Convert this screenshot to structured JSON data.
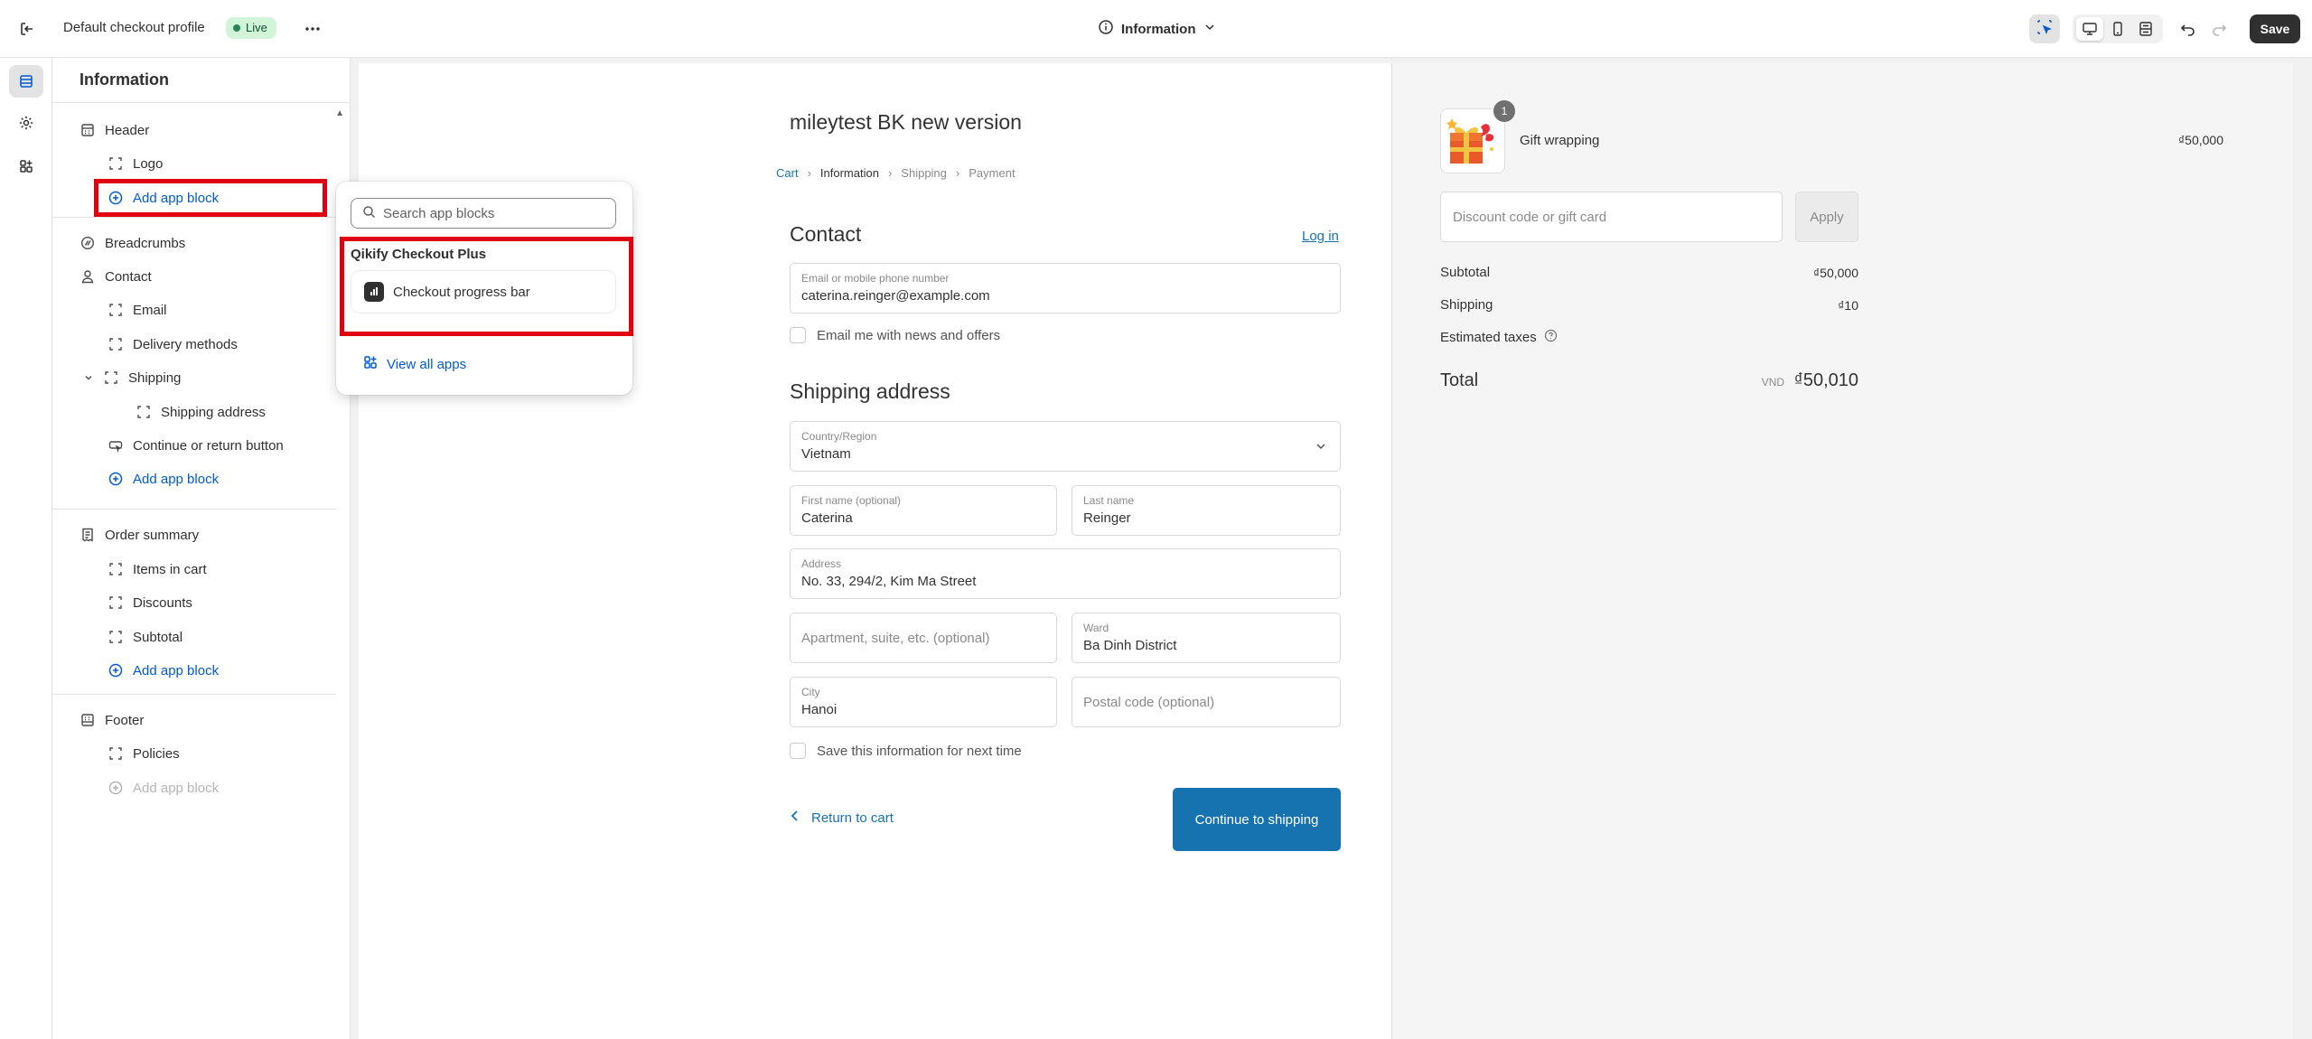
{
  "topbar": {
    "profile_title": "Default checkout profile",
    "status_badge": "Live",
    "page_selector": "Information",
    "save_label": "Save"
  },
  "sidebar": {
    "title": "Information",
    "items": {
      "header": "Header",
      "logo": "Logo",
      "add_app_block_1": "Add app block",
      "breadcrumbs": "Breadcrumbs",
      "contact": "Contact",
      "email": "Email",
      "delivery_methods": "Delivery methods",
      "shipping": "Shipping",
      "shipping_address": "Shipping address",
      "continue_return": "Continue or return button",
      "add_app_block_2": "Add app block",
      "order_summary": "Order summary",
      "items_in_cart": "Items in cart",
      "discounts": "Discounts",
      "subtotal": "Subtotal",
      "add_app_block_3": "Add app block",
      "footer": "Footer",
      "policies": "Policies",
      "add_app_block_4": "Add app block"
    }
  },
  "popover": {
    "search_placeholder": "Search app blocks",
    "app_name": "Qikify Checkout Plus",
    "block_name": "Checkout progress bar",
    "view_all": "View all apps"
  },
  "checkout": {
    "shop_name": "mileytest BK new version",
    "breadcrumbs": [
      "Cart",
      "Information",
      "Shipping",
      "Payment"
    ],
    "contact_heading": "Contact",
    "login_link": "Log in",
    "email_label": "Email or mobile phone number",
    "email_value": "caterina.reinger@example.com",
    "newsletter_label": "Email me with news and offers",
    "shipping_heading": "Shipping address",
    "country_label": "Country/Region",
    "country_value": "Vietnam",
    "first_name_label": "First name (optional)",
    "first_name_value": "Caterina",
    "last_name_label": "Last name",
    "last_name_value": "Reinger",
    "address_label": "Address",
    "address_value": "No. 33, 294/2, Kim Ma Street",
    "apartment_placeholder": "Apartment, suite, etc. (optional)",
    "ward_label": "Ward",
    "ward_value": "Ba Dinh District",
    "city_label": "City",
    "city_value": "Hanoi",
    "postal_placeholder": "Postal code (optional)",
    "save_info_label": "Save this information for next time",
    "return_link": "Return to cart",
    "continue_button": "Continue to shipping"
  },
  "summary": {
    "product_name": "Gift wrapping",
    "product_qty": "1",
    "product_price": "₫50,000",
    "discount_placeholder": "Discount code or gift card",
    "apply_label": "Apply",
    "subtotal_label": "Subtotal",
    "subtotal_value": "₫50,000",
    "shipping_label": "Shipping",
    "shipping_value": "₫10",
    "taxes_label": "Estimated taxes",
    "total_label": "Total",
    "total_currency": "VND",
    "total_value": "₫50,010"
  },
  "colors": {
    "accent_link": "#1773b0",
    "admin_link": "#005bd3",
    "highlight_box": "#e00010",
    "live_badge_bg": "#d3f5d7"
  },
  "icons": [
    "exit-icon",
    "more-icon",
    "info-icon",
    "chevron-down-icon",
    "select-tool-icon",
    "desktop-icon",
    "mobile-icon",
    "fullscreen-icon",
    "undo-icon",
    "redo-icon",
    "sections-icon",
    "settings-icon",
    "apps-icon",
    "search-icon",
    "plus-circle-icon",
    "block-icon"
  ]
}
